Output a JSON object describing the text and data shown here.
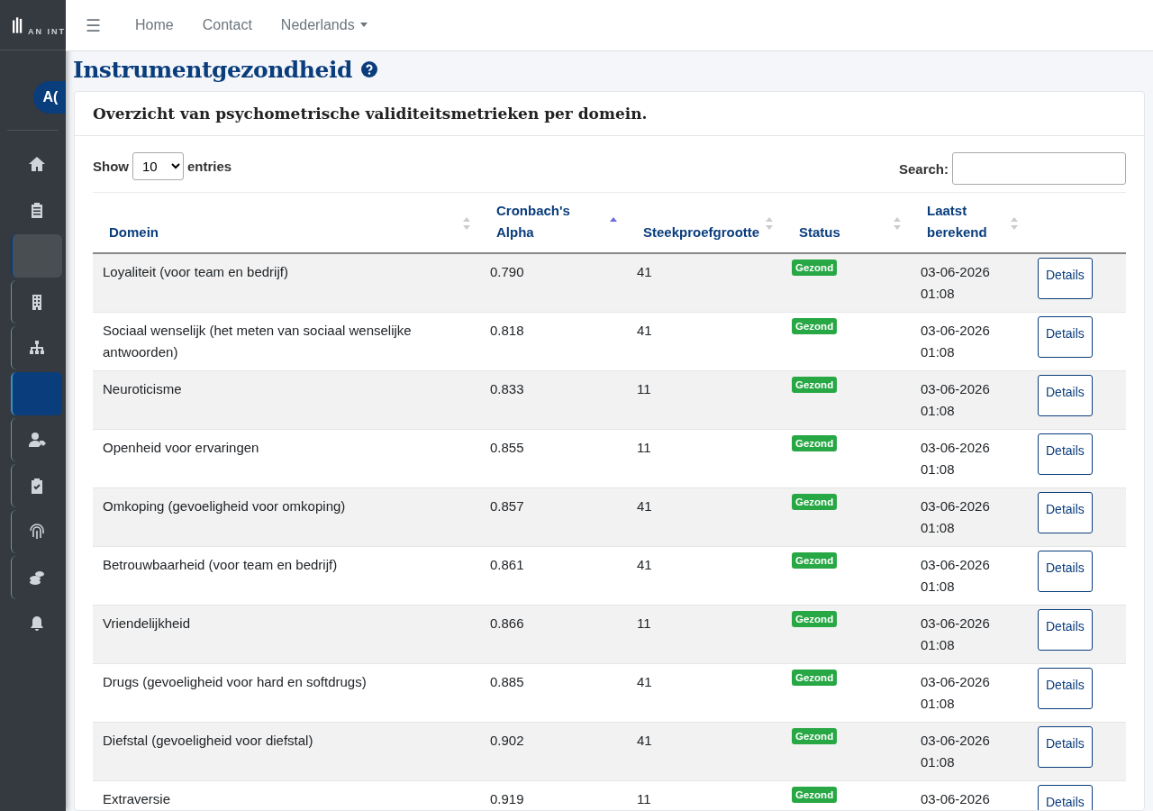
{
  "sidebar": {
    "logo_text": "AN INT",
    "avatar": "A(",
    "items": [
      {
        "kind": "icon",
        "grouped": false,
        "selected": false
      },
      {
        "kind": "icon",
        "grouped": false,
        "selected": false
      },
      {
        "kind": "blank",
        "grouped": false,
        "selected": false
      },
      {
        "kind": "icon",
        "grouped": true,
        "selected": false
      },
      {
        "kind": "icon",
        "grouped": true,
        "selected": false
      },
      {
        "kind": "blank",
        "grouped": false,
        "selected": true
      },
      {
        "kind": "icon",
        "grouped": true,
        "selected": false
      },
      {
        "kind": "icon",
        "grouped": true,
        "selected": false
      },
      {
        "kind": "icon",
        "grouped": true,
        "selected": false
      },
      {
        "kind": "icon",
        "grouped": true,
        "selected": false
      },
      {
        "kind": "icon",
        "grouped": false,
        "selected": false
      }
    ]
  },
  "navbar": {
    "menu_icon": "☰",
    "links": [
      "Home",
      "Contact"
    ],
    "language": "Nederlands"
  },
  "page": {
    "title": "Instrumentgezondheid"
  },
  "card": {
    "title": "Overzicht van psychometrische validiteitsmetrieken per domein.",
    "length": {
      "show": "Show",
      "value": "10",
      "entries": "entries"
    },
    "search": {
      "label": "Search:"
    },
    "columns": [
      {
        "label": "Domein",
        "sorted": false
      },
      {
        "label": "Cronbach's Alpha",
        "sorted": true
      },
      {
        "label": "Steekproefgrootte",
        "sorted": false
      },
      {
        "label": "Status",
        "sorted": false
      },
      {
        "label": "Laatst berekend",
        "sorted": false
      }
    ],
    "rows": [
      {
        "domain": "Loyaliteit (voor team en bedrijf)",
        "alpha": "0.790",
        "n": "41",
        "status": "Gezond",
        "date": "03-06-2026",
        "time": "01:08",
        "action": "Details"
      },
      {
        "domain": "Sociaal wenselijk (het meten van sociaal wenselijke antwoorden)",
        "alpha": "0.818",
        "n": "41",
        "status": "Gezond",
        "date": "03-06-2026",
        "time": "01:08",
        "action": "Details"
      },
      {
        "domain": "Neuroticisme",
        "alpha": "0.833",
        "n": "11",
        "status": "Gezond",
        "date": "03-06-2026",
        "time": "01:08",
        "action": "Details"
      },
      {
        "domain": "Openheid voor ervaringen",
        "alpha": "0.855",
        "n": "11",
        "status": "Gezond",
        "date": "03-06-2026",
        "time": "01:08",
        "action": "Details"
      },
      {
        "domain": "Omkoping (gevoeligheid voor omkoping)",
        "alpha": "0.857",
        "n": "41",
        "status": "Gezond",
        "date": "03-06-2026",
        "time": "01:08",
        "action": "Details"
      },
      {
        "domain": "Betrouwbaarheid (voor team en bedrijf)",
        "alpha": "0.861",
        "n": "41",
        "status": "Gezond",
        "date": "03-06-2026",
        "time": "01:08",
        "action": "Details"
      },
      {
        "domain": "Vriendelijkheid",
        "alpha": "0.866",
        "n": "11",
        "status": "Gezond",
        "date": "03-06-2026",
        "time": "01:08",
        "action": "Details"
      },
      {
        "domain": "Drugs (gevoeligheid voor hard en softdrugs)",
        "alpha": "0.885",
        "n": "41",
        "status": "Gezond",
        "date": "03-06-2026",
        "time": "01:08",
        "action": "Details"
      },
      {
        "domain": "Diefstal (gevoeligheid voor diefstal)",
        "alpha": "0.902",
        "n": "41",
        "status": "Gezond",
        "date": "03-06-2026",
        "time": "01:08",
        "action": "Details"
      },
      {
        "domain": "Extraversie",
        "alpha": "0.919",
        "n": "11",
        "status": "Gezond",
        "date": "03-06-2026",
        "action": "Details"
      }
    ]
  }
}
